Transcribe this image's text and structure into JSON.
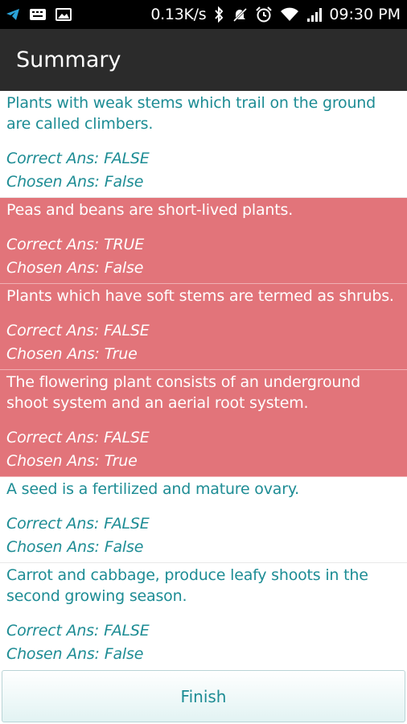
{
  "status_bar": {
    "network_speed": "0.13K/s",
    "time": "09:30 PM",
    "icons": [
      "telegram-icon",
      "keyboard-icon",
      "image-icon",
      "bluetooth-icon",
      "mute-icon",
      "alarm-icon",
      "wifi-icon",
      "signal-icon"
    ]
  },
  "action_bar": {
    "title": "Summary"
  },
  "labels": {
    "correct_prefix": "Correct Ans:",
    "chosen_prefix": "Chosen Ans:"
  },
  "results": [
    {
      "question": "Plants with weak stems which trail on the ground are called climbers.",
      "correct": "FALSE",
      "chosen": "False",
      "is_correct": true
    },
    {
      "question": "Peas and beans are short-lived plants.",
      "correct": "TRUE",
      "chosen": "False",
      "is_correct": false
    },
    {
      "question": "Plants which have soft stems are termed as shrubs.",
      "correct": "FALSE",
      "chosen": "True",
      "is_correct": false
    },
    {
      "question": "The flowering plant consists of an underground shoot system and an aerial root system.",
      "correct": "FALSE",
      "chosen": "True",
      "is_correct": false
    },
    {
      "question": "A seed is a fertilized and mature ovary.",
      "correct": "FALSE",
      "chosen": "False",
      "is_correct": true
    },
    {
      "question": "Carrot and cabbage, produce leafy shoots in the second growing season.",
      "correct": "FALSE",
      "chosen": "False",
      "is_correct": true
    }
  ],
  "footer": {
    "finish_label": "Finish"
  },
  "colors": {
    "wrong_row_bg": "#e2747a",
    "text_teal": "#1d8c94",
    "action_bar_bg": "#2b2b2b"
  }
}
